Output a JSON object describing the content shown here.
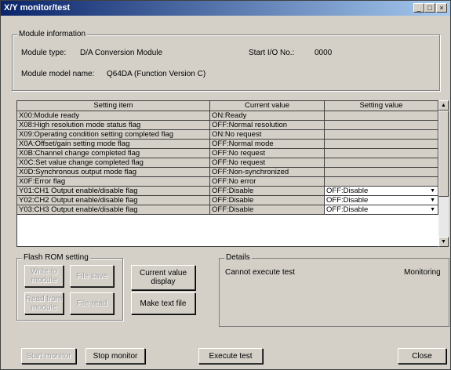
{
  "window": {
    "title": "X/Y monitor/test",
    "min": "_",
    "max": "□",
    "close": "×"
  },
  "module_info": {
    "legend": "Module information",
    "type_label": "Module type:",
    "type_value": "D/A Conversion Module",
    "start_io_label": "Start I/O No.:",
    "start_io_value": "0000",
    "model_label": "Module model name:",
    "model_value": "Q64DA (Function Version C)"
  },
  "table": {
    "headers": [
      "Setting item",
      "Current value",
      "Setting value"
    ],
    "rows": [
      {
        "item": "X00:Module ready",
        "current": "ON:Ready",
        "setting": ""
      },
      {
        "item": "X08:High resolution mode status flag",
        "current": "OFF:Normal resolution",
        "setting": ""
      },
      {
        "item": "X09:Operating condition setting completed flag",
        "current": "ON:No request",
        "setting": ""
      },
      {
        "item": "X0A:Offset/gain setting mode flag",
        "current": "OFF:Normal mode",
        "setting": ""
      },
      {
        "item": "X0B:Channel change completed flag",
        "current": "OFF:No request",
        "setting": ""
      },
      {
        "item": "X0C:Set value change completed flag",
        "current": "OFF:No request",
        "setting": ""
      },
      {
        "item": "X0D:Synchronous output mode flag",
        "current": "OFF:Non-synchronized",
        "setting": ""
      },
      {
        "item": "X0F:Error flag",
        "current": "OFF:No error",
        "setting": ""
      },
      {
        "item": "Y01:CH1 Output enable/disable flag",
        "current": "OFF:Disable",
        "setting": "OFF:Disable"
      },
      {
        "item": "Y02:CH2 Output enable/disable flag",
        "current": "OFF:Disable",
        "setting": "OFF:Disable"
      },
      {
        "item": "Y03:CH3 Output enable/disable flag",
        "current": "OFF:Disable",
        "setting": "OFF:Disable"
      }
    ]
  },
  "flash_rom": {
    "legend": "Flash ROM setting",
    "write_to_module": "Write to module",
    "file_save": "File save",
    "read_from_module": "Read from module",
    "file_read": "File read"
  },
  "current_value_display": "Current value display",
  "make_text_file": "Make text file",
  "details": {
    "legend": "Details",
    "message": "Cannot execute test",
    "status": "Monitoring"
  },
  "bottom": {
    "start_monitor": "Start monitor",
    "stop_monitor": "Stop monitor",
    "execute_test": "Execute test",
    "close": "Close"
  }
}
